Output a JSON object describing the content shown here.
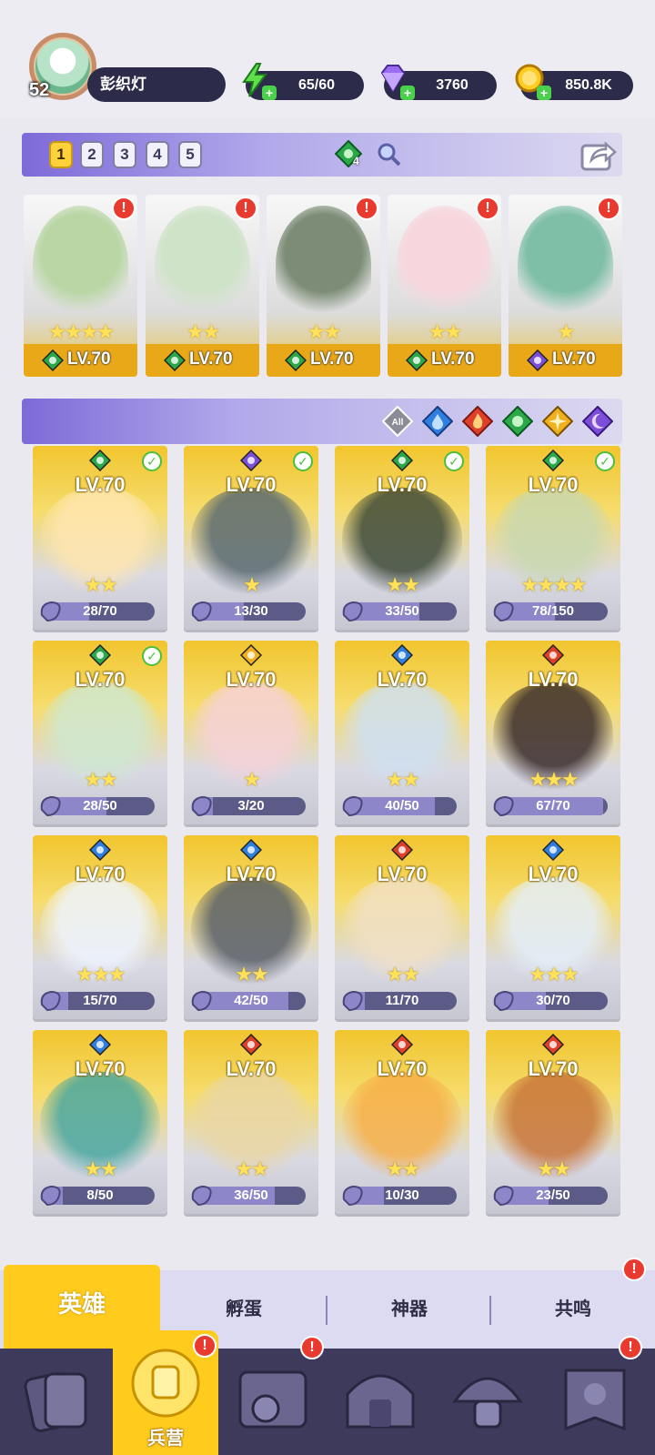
{
  "player": {
    "level": "52",
    "name": "彭织灯"
  },
  "resources": [
    {
      "name": "energy",
      "icon": "lightning-icon",
      "value": "65/60"
    },
    {
      "name": "gems",
      "icon": "diamond-icon",
      "value": "3760"
    },
    {
      "name": "gold",
      "icon": "coin-icon",
      "value": "850.8K"
    }
  ],
  "team_tabs": [
    "1",
    "2",
    "3",
    "4",
    "5"
  ],
  "team_active": "1",
  "team_gem_count": "4",
  "team": [
    {
      "level": "LV.70",
      "stars": "★★★★",
      "element": "nature",
      "alert": "!"
    },
    {
      "level": "LV.70",
      "stars": "★★",
      "element": "nature",
      "alert": "!"
    },
    {
      "level": "LV.70",
      "stars": "★★",
      "element": "nature",
      "alert": "!"
    },
    {
      "level": "LV.70",
      "stars": "★★",
      "element": "nature",
      "alert": "!"
    },
    {
      "level": "LV.70",
      "stars": "★",
      "element": "dark",
      "alert": "!"
    }
  ],
  "filters": {
    "all": "All",
    "elements": [
      "water",
      "fire",
      "nature",
      "light",
      "dark"
    ]
  },
  "heroes": [
    {
      "level": "LV.70",
      "element": "nature",
      "stars": "★★",
      "progress": "28/70",
      "fill": 0.4,
      "checked": true
    },
    {
      "level": "LV.70",
      "element": "dark",
      "stars": "★",
      "progress": "13/30",
      "fill": 0.43,
      "checked": true
    },
    {
      "level": "LV.70",
      "element": "nature",
      "stars": "★★",
      "progress": "33/50",
      "fill": 0.66,
      "checked": true
    },
    {
      "level": "LV.70",
      "element": "nature",
      "stars": "★★★★",
      "progress": "78/150",
      "fill": 0.52,
      "checked": true
    },
    {
      "level": "LV.70",
      "element": "nature",
      "stars": "★★",
      "progress": "28/50",
      "fill": 0.56,
      "checked": true
    },
    {
      "level": "LV.70",
      "element": "light",
      "stars": "★",
      "progress": "3/20",
      "fill": 0.15,
      "checked": false
    },
    {
      "level": "LV.70",
      "element": "water",
      "stars": "★★",
      "progress": "40/50",
      "fill": 0.8,
      "checked": false
    },
    {
      "level": "LV.70",
      "element": "fire",
      "stars": "★★★",
      "progress": "67/70",
      "fill": 0.96,
      "checked": false
    },
    {
      "level": "LV.70",
      "element": "water",
      "stars": "★★★",
      "progress": "15/70",
      "fill": 0.21,
      "checked": false
    },
    {
      "level": "LV.70",
      "element": "water",
      "stars": "★★",
      "progress": "42/50",
      "fill": 0.84,
      "checked": false
    },
    {
      "level": "LV.70",
      "element": "fire",
      "stars": "★★",
      "progress": "11/70",
      "fill": 0.16,
      "checked": false
    },
    {
      "level": "LV.70",
      "element": "water",
      "stars": "★★★",
      "progress": "30/70",
      "fill": 0.43,
      "checked": false
    },
    {
      "level": "LV.70",
      "element": "water",
      "stars": "★★",
      "progress": "8/50",
      "fill": 0.16,
      "checked": false
    },
    {
      "level": "LV.70",
      "element": "fire",
      "stars": "★★",
      "progress": "36/50",
      "fill": 0.72,
      "checked": false
    },
    {
      "level": "LV.70",
      "element": "fire",
      "stars": "★★",
      "progress": "10/30",
      "fill": 0.33,
      "checked": false
    },
    {
      "level": "LV.70",
      "element": "fire",
      "stars": "★★",
      "progress": "23/50",
      "fill": 0.46,
      "checked": false
    }
  ],
  "subtabs": [
    "英雄",
    "孵蛋",
    "神器",
    "共鸣"
  ],
  "subtab_alert": "!",
  "nav": {
    "active_label": "兵营",
    "alert": "!"
  },
  "colors": {
    "nature": "#2aa84a",
    "water": "#2f7fe0",
    "fire": "#e0402a",
    "light": "#f0b020",
    "dark": "#7d4fd8",
    "accent": "#ffcc1e"
  }
}
